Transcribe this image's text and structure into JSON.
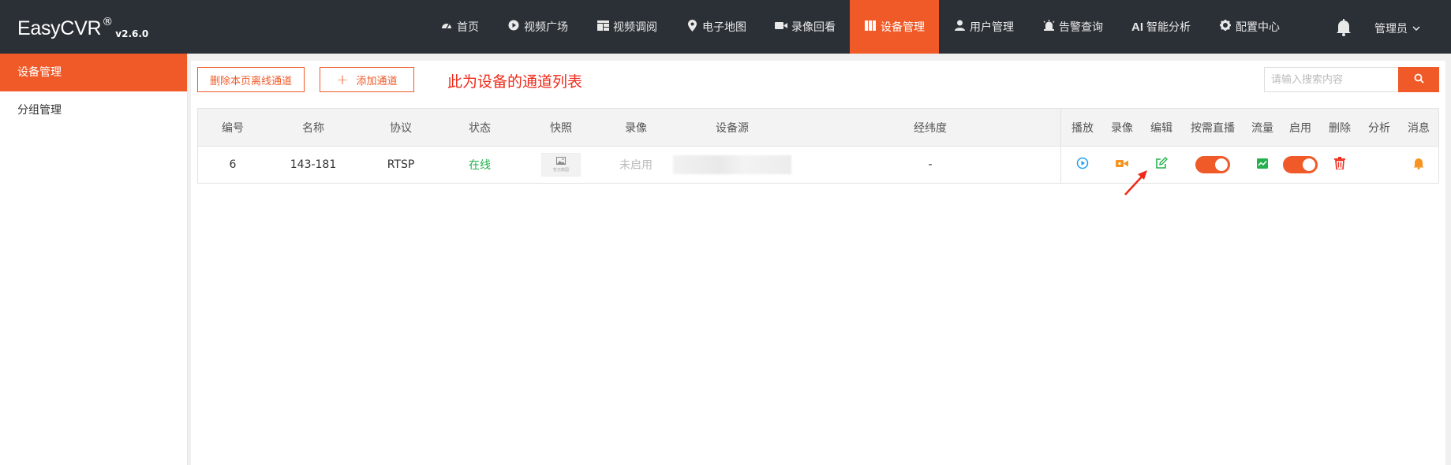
{
  "brand": {
    "name": "EasyCVR",
    "reg": "®",
    "version": "v2.6.0"
  },
  "nav": [
    {
      "label": "首页",
      "icon": "dashboard-icon"
    },
    {
      "label": "视频广场",
      "icon": "play-circle-icon"
    },
    {
      "label": "视频调阅",
      "icon": "grid-icon"
    },
    {
      "label": "电子地图",
      "icon": "map-pin-icon"
    },
    {
      "label": "录像回看",
      "icon": "video-camera-icon"
    },
    {
      "label": "设备管理",
      "icon": "columns-icon",
      "active": true
    },
    {
      "label": "用户管理",
      "icon": "user-icon"
    },
    {
      "label": "告警查询",
      "icon": "alarm-icon"
    },
    {
      "label": "智能分析",
      "prefix": "AI"
    },
    {
      "label": "配置中心",
      "icon": "gear-icon"
    }
  ],
  "header": {
    "user": "管理员"
  },
  "sidebar": {
    "items": [
      {
        "label": "设备管理",
        "active": true
      },
      {
        "label": "分组管理"
      }
    ]
  },
  "toolbar": {
    "delete_offline_label": "删除本页离线通道",
    "add_channel_label": "添加通道",
    "annotation": "此为设备的通道列表",
    "search_placeholder": "请输入搜索内容"
  },
  "table": {
    "columns": [
      "编号",
      "名称",
      "协议",
      "状态",
      "快照",
      "录像",
      "设备源",
      "经纬度",
      "播放",
      "录像",
      "编辑",
      "按需直播",
      "流量",
      "启用",
      "删除",
      "分析",
      "消息"
    ],
    "rows": [
      {
        "id": "6",
        "name": "143-181",
        "protocol": "RTSP",
        "status": "在线",
        "snapshot_text": "暂无截图",
        "record": "未启用",
        "latlng": "-",
        "on_demand": true,
        "enabled": true
      }
    ]
  },
  "colors": {
    "accent": "#f05a28",
    "online": "#22b14c",
    "annotation": "#ef2a1a",
    "header_bg": "#2b3036"
  }
}
